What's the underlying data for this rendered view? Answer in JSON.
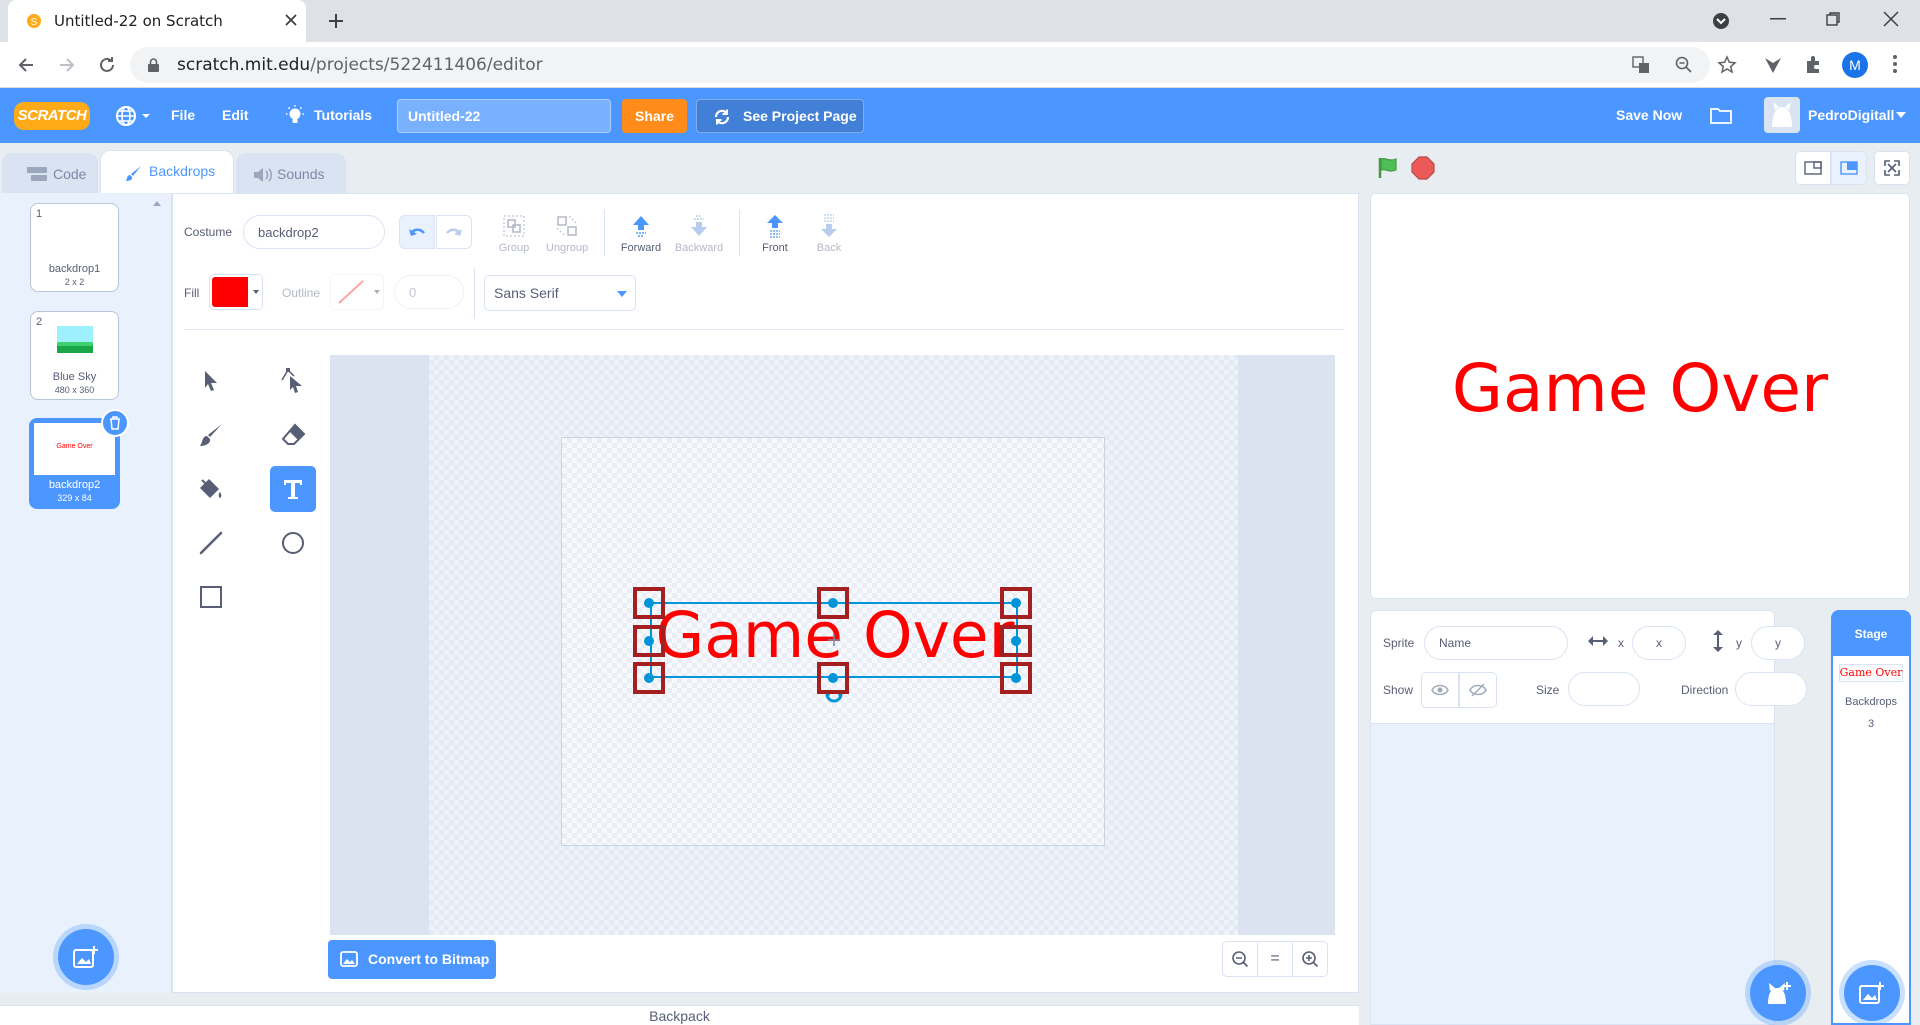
{
  "browser": {
    "tab_title": "Untitled-22 on Scratch",
    "url_host": "scratch.mit.edu",
    "url_path": "/projects/522411406/editor",
    "profile_initial": "M"
  },
  "menubar": {
    "logo": "SCRATCH",
    "file": "File",
    "edit": "Edit",
    "tutorials": "Tutorials",
    "project_title": "Untitled-22",
    "share": "Share",
    "see_project_page": "See Project Page",
    "save_now": "Save Now",
    "username": "PedroDigitall"
  },
  "editor_tabs": [
    {
      "label": "Code"
    },
    {
      "label": "Backdrops"
    },
    {
      "label": "Sounds"
    }
  ],
  "costumes": [
    {
      "num": "1",
      "name": "backdrop1",
      "size": "2 x 2"
    },
    {
      "num": "2",
      "name": "Blue Sky",
      "size": "480 x 360"
    },
    {
      "num": "3",
      "name": "backdrop2",
      "size": "329 x 84",
      "thumb_text": "Game Over"
    }
  ],
  "paint": {
    "costume_label": "Costume",
    "costume_name": "backdrop2",
    "group": "Group",
    "ungroup": "Ungroup",
    "forward": "Forward",
    "backward": "Backward",
    "front": "Front",
    "back": "Back",
    "fill_label": "Fill",
    "outline_label": "Outline",
    "outline_width": "0",
    "font": "Sans Serif",
    "fill_color": "#ff0000",
    "canvas_text": "Game Over",
    "convert": "Convert to Bitmap",
    "zoom_reset": "="
  },
  "backpack": "Backpack",
  "stage": {
    "text": "Game Over"
  },
  "sprite_info": {
    "sprite_label": "Sprite",
    "name_placeholder": "Name",
    "x_label": "x",
    "x_placeholder": "x",
    "y_label": "y",
    "y_placeholder": "y",
    "show_label": "Show",
    "size_label": "Size",
    "direction_label": "Direction"
  },
  "stage_selector": {
    "header": "Stage",
    "thumb_text": "Game Over",
    "backdrops_label": "Backdrops",
    "backdrops_count": "3"
  },
  "colors": {
    "scratch_blue": "#4c97ff",
    "share_orange": "#ff8c1a",
    "text_red": "#ff0000"
  }
}
